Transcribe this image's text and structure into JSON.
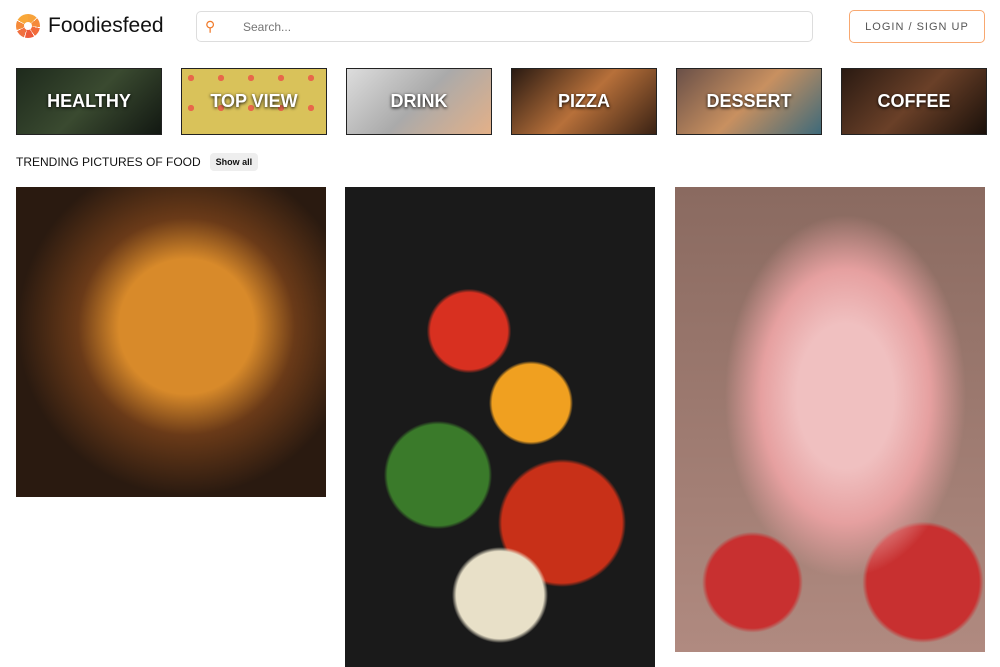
{
  "header": {
    "brand": "Foodiesfeed",
    "search_placeholder": "Search...",
    "login_label": "LOGIN / SIGN UP"
  },
  "categories": [
    {
      "label": "HEALTHY"
    },
    {
      "label": "TOP VIEW"
    },
    {
      "label": "DRINK"
    },
    {
      "label": "PIZZA"
    },
    {
      "label": "DESSERT"
    },
    {
      "label": "COFFEE"
    }
  ],
  "trending": {
    "title": "TRENDING PICTURES OF FOOD",
    "show_all": "Show all"
  },
  "colors": {
    "accent": "#f07a2a"
  }
}
